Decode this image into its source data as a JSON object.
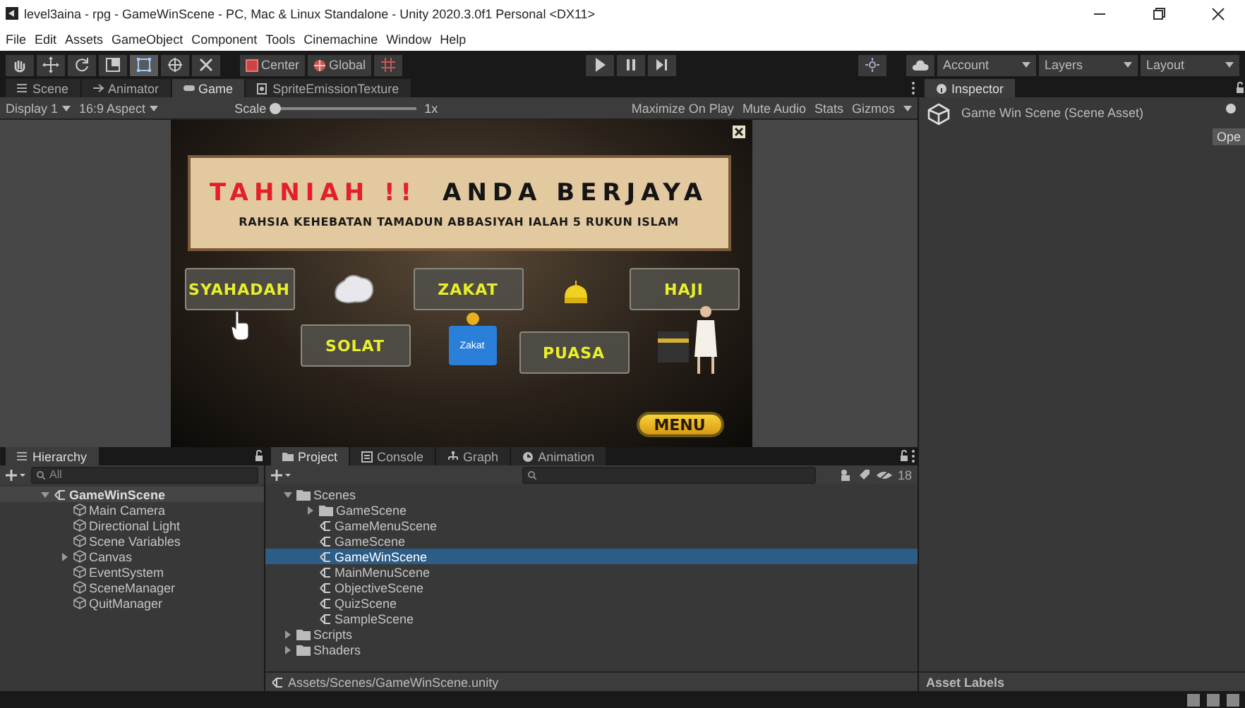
{
  "window": {
    "title": "level3aina - rpg - GameWinScene - PC, Mac & Linux Standalone - Unity 2020.3.0f1 Personal <DX11>"
  },
  "menu": [
    "File",
    "Edit",
    "Assets",
    "GameObject",
    "Component",
    "Tools",
    "Cinemachine",
    "Window",
    "Help"
  ],
  "toolbar": {
    "tools": [
      {
        "selected": false
      },
      {
        "selected": false
      },
      {
        "selected": false
      },
      {
        "selected": false
      },
      {
        "selected": true
      },
      {
        "selected": false
      },
      {
        "selected": false
      }
    ],
    "pivot": "Center",
    "space": "Global",
    "dropdowns": [
      "Account",
      "Layers",
      "Layout"
    ]
  },
  "view_tabs": [
    {
      "label": "Scene",
      "selected": false
    },
    {
      "label": "Animator",
      "selected": false
    },
    {
      "label": "Game",
      "selected": true
    },
    {
      "label": "SpriteEmissionTexture",
      "selected": false
    }
  ],
  "game_toolbar": {
    "display": "Display 1",
    "aspect": "16:9 Aspect",
    "scale_label": "Scale",
    "scale": {
      "level": 0
    },
    "scale_value": "1x",
    "options": [
      "Maximize On Play",
      "Mute Audio",
      "Stats",
      "Gizmos"
    ]
  },
  "game": {
    "heading": "TAHNIAH !!",
    "heading_rest": "ANDA BERJAYA",
    "subtitle": "RAHSIA KEHEBATAN TAMADUN ABBASIYAH IALAH 5 RUKUN ISLAM",
    "pillars": [
      {
        "label": "SYAHADAH"
      },
      {
        "label": "ZAKAT"
      },
      {
        "label": "HAJI"
      },
      {
        "label": "SOLAT"
      },
      {
        "label": "PUASA"
      }
    ],
    "zakat_box_label": "Zakat",
    "menu_button": "MENU"
  },
  "inspector": {
    "tab": "Inspector",
    "asset_title": "Game Win Scene (Scene Asset)",
    "open_button": "Ope",
    "footer": "Asset Labels"
  },
  "hierarchy": {
    "tab": "Hierarchy",
    "search_placeholder": "All",
    "tree": [
      {
        "label": "GameWinScene",
        "expanded": true,
        "children": [
          {
            "label": "Main Camera"
          },
          {
            "label": "Directional Light"
          },
          {
            "label": "Scene Variables"
          },
          {
            "label": "Canvas",
            "expanded": false
          },
          {
            "label": "EventSystem"
          },
          {
            "label": "SceneManager"
          },
          {
            "label": "QuitManager"
          }
        ]
      }
    ]
  },
  "project": {
    "tabs": [
      {
        "label": "Project",
        "selected": true
      },
      {
        "label": "Console",
        "selected": false
      },
      {
        "label": "Graph",
        "selected": false
      },
      {
        "label": "Animation",
        "selected": false
      }
    ],
    "hidden_count": "18",
    "tree": [
      {
        "label": "Scenes",
        "kind": "folder",
        "expanded": true,
        "selected": false,
        "children": [
          {
            "label": "GameScene",
            "kind": "folder",
            "expanded": false,
            "selected": false
          },
          {
            "label": "GameMenuScene",
            "kind": "scene",
            "selected": false
          },
          {
            "label": "GameScene",
            "kind": "scene",
            "selected": false
          },
          {
            "label": "GameWinScene",
            "kind": "scene",
            "selected": true
          },
          {
            "label": "MainMenuScene",
            "kind": "scene",
            "selected": false
          },
          {
            "label": "ObjectiveScene",
            "kind": "scene",
            "selected": false
          },
          {
            "label": "QuizScene",
            "kind": "scene",
            "selected": false
          },
          {
            "label": "SampleScene",
            "kind": "scene",
            "selected": false
          }
        ]
      },
      {
        "label": "Scripts",
        "kind": "folder",
        "expanded": false,
        "selected": false
      },
      {
        "label": "Shaders",
        "kind": "folder",
        "expanded": false,
        "selected": false
      }
    ],
    "path": "Assets/Scenes/GameWinScene.unity"
  }
}
